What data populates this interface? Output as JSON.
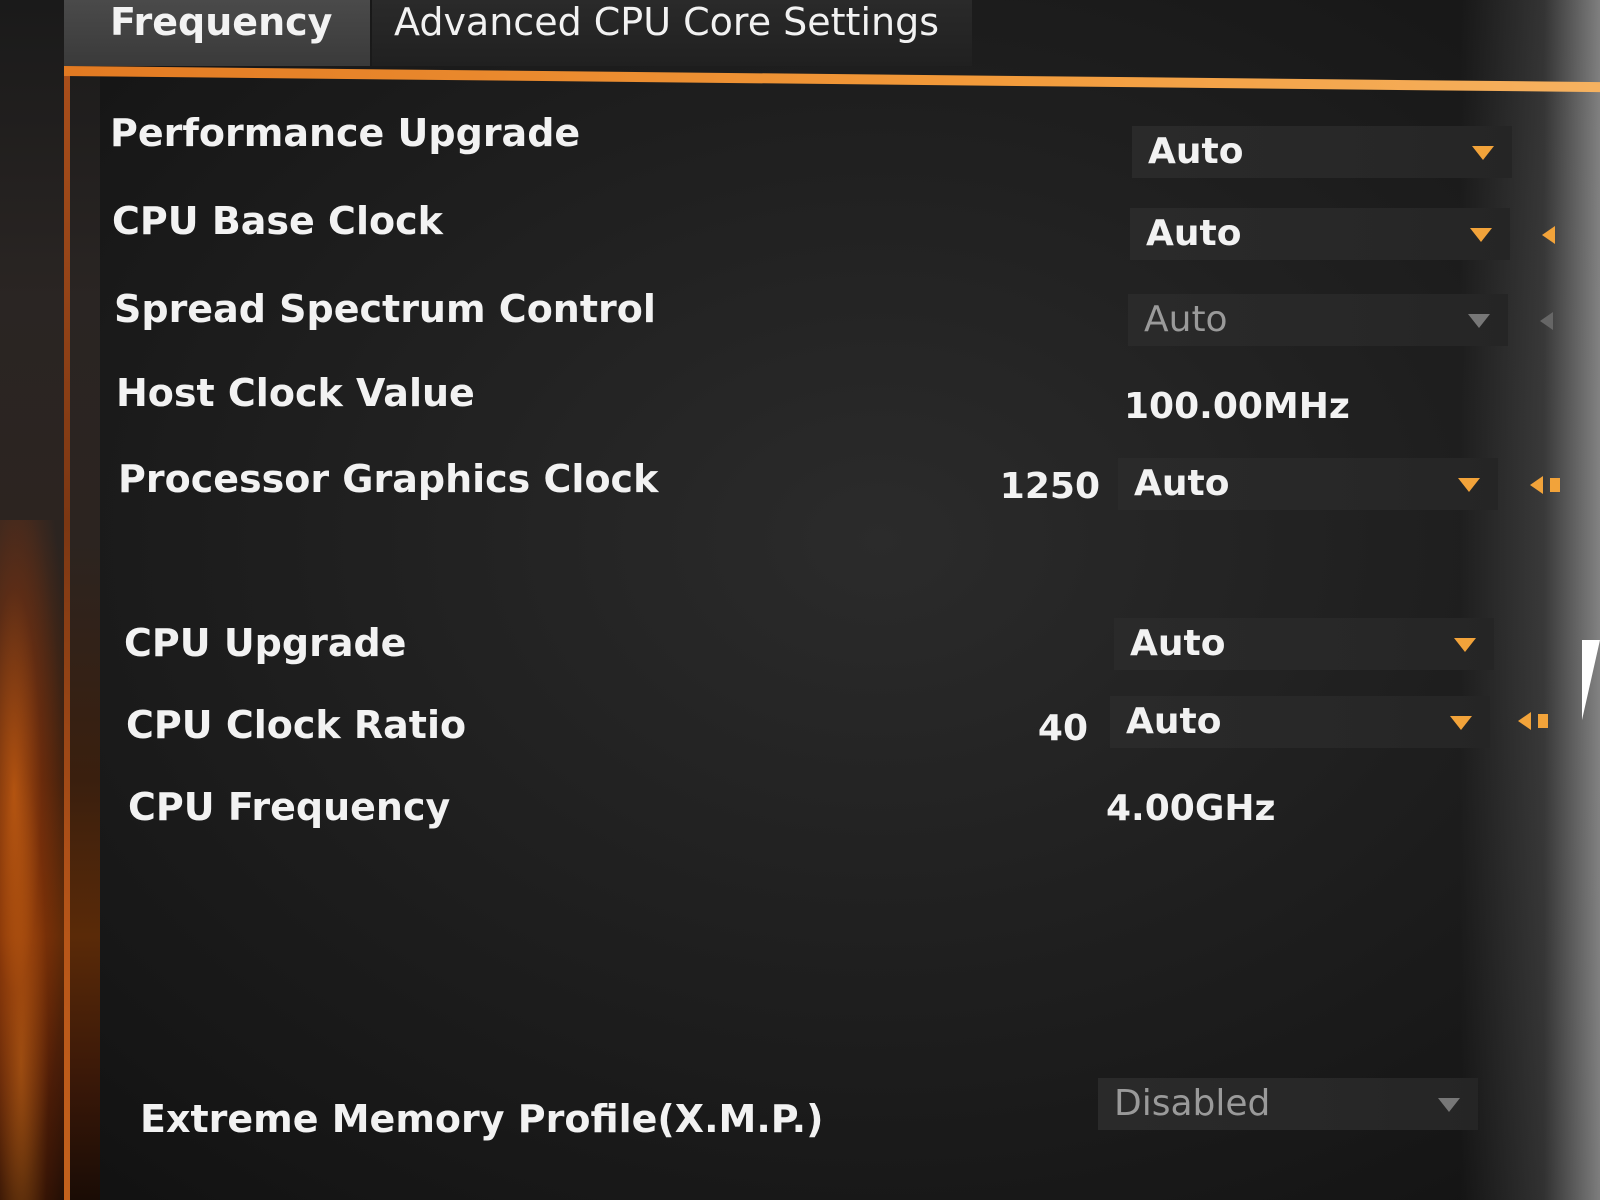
{
  "tabs": [
    {
      "label": "Frequency"
    },
    {
      "label": "Advanced CPU Core Settings"
    }
  ],
  "settings": [
    {
      "label": "Performance Upgrade",
      "value": "Auto"
    },
    {
      "label": "CPU Base Clock",
      "value": "Auto"
    },
    {
      "label": "Spread Spectrum Control",
      "value": "Auto"
    },
    {
      "label": "Host Clock Value",
      "value": "100.00MHz"
    },
    {
      "label": "Processor Graphics Clock",
      "current": "1250",
      "value": "Auto"
    },
    {
      "label": "CPU Upgrade",
      "value": "Auto"
    },
    {
      "label": "CPU Clock Ratio",
      "current": "40",
      "value": "Auto"
    },
    {
      "label": "CPU Frequency",
      "value": "4.00GHz"
    },
    {
      "label": "Extreme Memory Profile(X.M.P.)",
      "value": "Disabled"
    }
  ],
  "colors": {
    "accent": "#f2a33a",
    "tab_underline": "#e27a22",
    "text": "#f2f2f2",
    "disabled_text": "#9a9a9a"
  },
  "icons": [
    "chevron-down-icon",
    "arrow-left-icon",
    "mouse-cursor-icon"
  ]
}
